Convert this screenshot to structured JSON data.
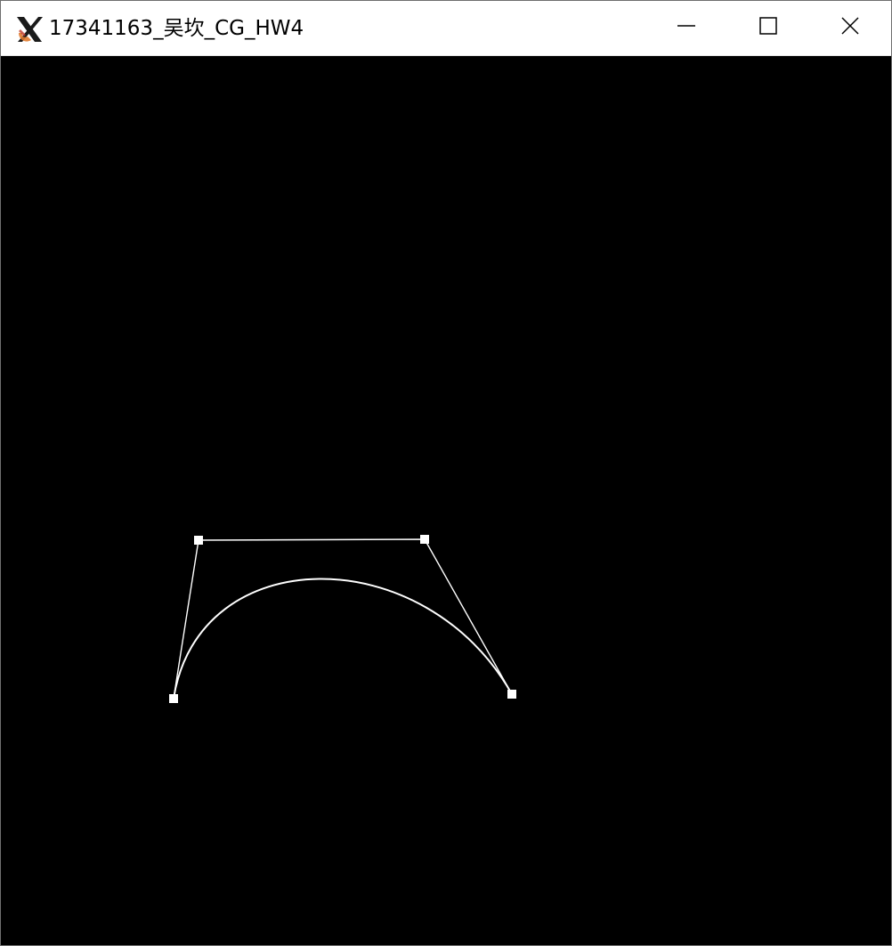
{
  "window": {
    "title": "17341163_吴坎_CG_HW4",
    "icon": "x-app-icon",
    "controls": {
      "minimize": "minimize-icon",
      "maximize": "maximize-icon",
      "close": "close-icon"
    }
  },
  "canvas": {
    "background": "#000000",
    "stroke_color": "#ffffff",
    "content": "bezier-curve-editor",
    "control_points_count": 4
  }
}
